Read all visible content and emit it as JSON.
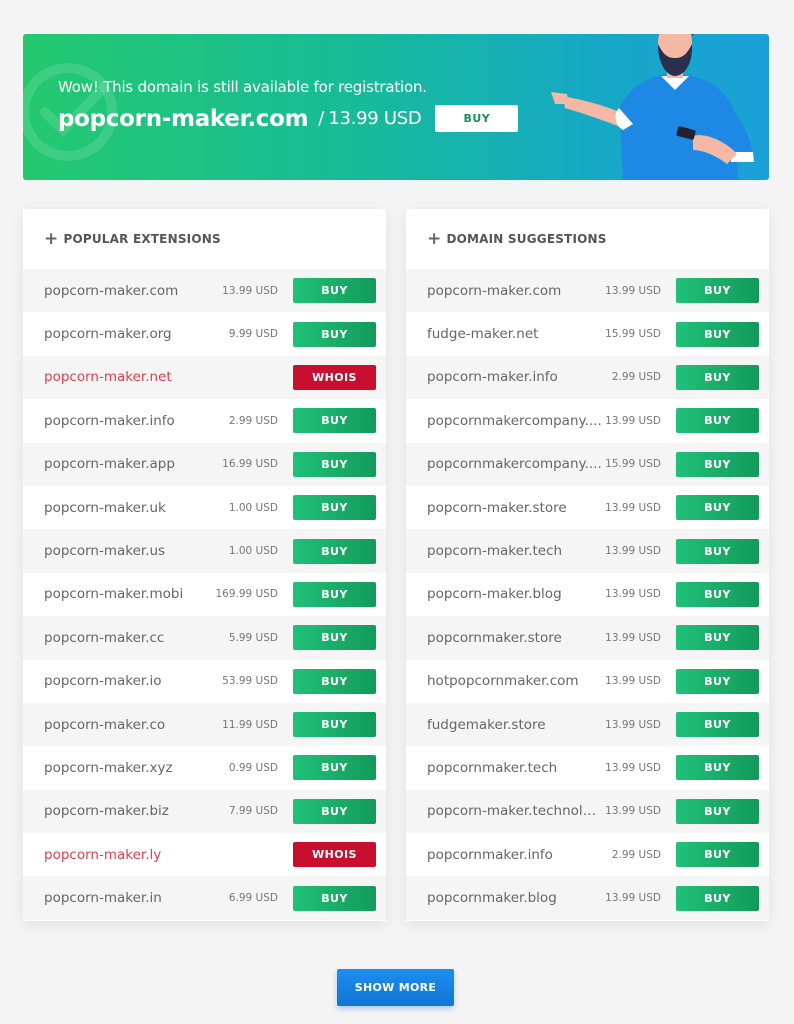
{
  "hero": {
    "subtitle": "Wow! This domain is still available for registration.",
    "domain": "popcorn-maker.com",
    "separator": "/",
    "price": "13.99 USD",
    "buy_label": "BUY",
    "gradient_start": "#24c96e",
    "gradient_end": "#1aa0d8"
  },
  "popular": {
    "title": "POPULAR EXTENSIONS",
    "rows": [
      {
        "name": "popcorn-maker.com",
        "price": "13.99 USD",
        "action": "BUY",
        "status": "available"
      },
      {
        "name": "popcorn-maker.org",
        "price": "9.99 USD",
        "action": "BUY",
        "status": "available"
      },
      {
        "name": "popcorn-maker.net",
        "price": "",
        "action": "WHOIS",
        "status": "taken"
      },
      {
        "name": "popcorn-maker.info",
        "price": "2.99 USD",
        "action": "BUY",
        "status": "available"
      },
      {
        "name": "popcorn-maker.app",
        "price": "16.99 USD",
        "action": "BUY",
        "status": "available"
      },
      {
        "name": "popcorn-maker.uk",
        "price": "1.00 USD",
        "action": "BUY",
        "status": "available"
      },
      {
        "name": "popcorn-maker.us",
        "price": "1.00 USD",
        "action": "BUY",
        "status": "available"
      },
      {
        "name": "popcorn-maker.mobi",
        "price": "169.99 USD",
        "action": "BUY",
        "status": "available"
      },
      {
        "name": "popcorn-maker.cc",
        "price": "5.99 USD",
        "action": "BUY",
        "status": "available"
      },
      {
        "name": "popcorn-maker.io",
        "price": "53.99 USD",
        "action": "BUY",
        "status": "available"
      },
      {
        "name": "popcorn-maker.co",
        "price": "11.99 USD",
        "action": "BUY",
        "status": "available"
      },
      {
        "name": "popcorn-maker.xyz",
        "price": "0.99 USD",
        "action": "BUY",
        "status": "available"
      },
      {
        "name": "popcorn-maker.biz",
        "price": "7.99 USD",
        "action": "BUY",
        "status": "available"
      },
      {
        "name": "popcorn-maker.ly",
        "price": "",
        "action": "WHOIS",
        "status": "taken"
      },
      {
        "name": "popcorn-maker.in",
        "price": "6.99 USD",
        "action": "BUY",
        "status": "available"
      }
    ]
  },
  "suggestions": {
    "title": "DOMAIN SUGGESTIONS",
    "rows": [
      {
        "name": "popcorn-maker.com",
        "price": "13.99 USD",
        "action": "BUY",
        "status": "available"
      },
      {
        "name": "fudge-maker.net",
        "price": "15.99 USD",
        "action": "BUY",
        "status": "available"
      },
      {
        "name": "popcorn-maker.info",
        "price": "2.99 USD",
        "action": "BUY",
        "status": "available"
      },
      {
        "name": "popcornmakercompany....",
        "price": "13.99 USD",
        "action": "BUY",
        "status": "available"
      },
      {
        "name": "popcornmakercompany....",
        "price": "15.99 USD",
        "action": "BUY",
        "status": "available"
      },
      {
        "name": "popcorn-maker.store",
        "price": "13.99 USD",
        "action": "BUY",
        "status": "available"
      },
      {
        "name": "popcorn-maker.tech",
        "price": "13.99 USD",
        "action": "BUY",
        "status": "available"
      },
      {
        "name": "popcorn-maker.blog",
        "price": "13.99 USD",
        "action": "BUY",
        "status": "available"
      },
      {
        "name": "popcornmaker.store",
        "price": "13.99 USD",
        "action": "BUY",
        "status": "available"
      },
      {
        "name": "hotpopcornmaker.com",
        "price": "13.99 USD",
        "action": "BUY",
        "status": "available"
      },
      {
        "name": "fudgemaker.store",
        "price": "13.99 USD",
        "action": "BUY",
        "status": "available"
      },
      {
        "name": "popcornmaker.tech",
        "price": "13.99 USD",
        "action": "BUY",
        "status": "available"
      },
      {
        "name": "popcorn-maker.technology",
        "price": "13.99 USD",
        "action": "BUY",
        "status": "available"
      },
      {
        "name": "popcornmaker.info",
        "price": "2.99 USD",
        "action": "BUY",
        "status": "available"
      },
      {
        "name": "popcornmaker.blog",
        "price": "13.99 USD",
        "action": "BUY",
        "status": "available"
      }
    ]
  },
  "show_more_label": "SHOW MORE",
  "colors": {
    "buy": "#1aae6a",
    "whois": "#c8102e",
    "taken_text": "#e03e4e",
    "show_more": "#1585e6"
  },
  "icons": {
    "plus": "plus-icon",
    "hero_watermark": "check-circle-icon",
    "hero_person": "person-illustration"
  }
}
